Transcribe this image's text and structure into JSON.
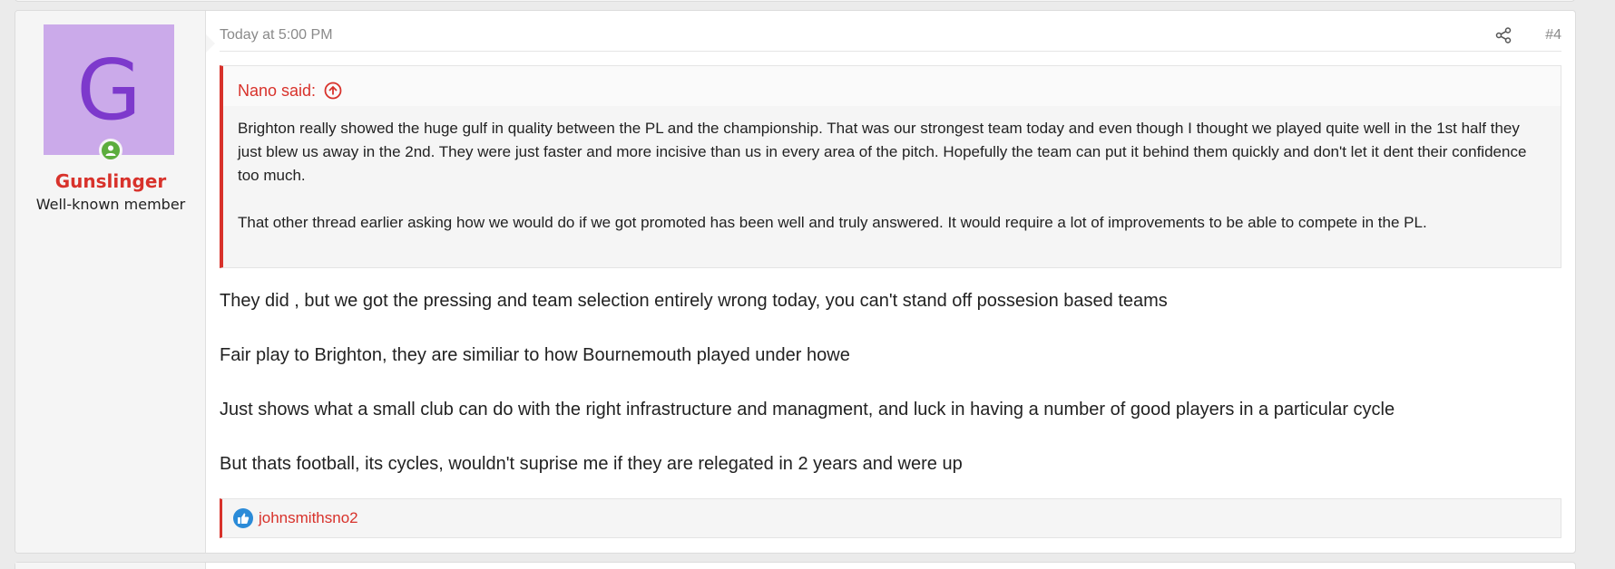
{
  "post": {
    "author": {
      "avatar_letter": "G",
      "username": "Gunslinger",
      "title": "Well-known member",
      "avatar_bg": "#cbaaea",
      "avatar_fg": "#7d39cc",
      "online_icon": "user-online-icon"
    },
    "header": {
      "timestamp": "Today at 5:00 PM",
      "share_icon": "share-icon",
      "post_number": "#4"
    },
    "quote": {
      "attribution": "Nano said:",
      "jump_icon": "arrow-up-circle-icon",
      "paragraphs": [
        "Brighton really showed the huge gulf in quality between the PL and the championship. That was our strongest team today and even though I thought we played quite well in the 1st half they just blew us away in the 2nd. They were just faster and more incisive than us in every area of the pitch. Hopefully the team can put it behind them quickly and don't let it dent their confidence too much.",
        "That other thread earlier asking how we would do if we got promoted has been well and truly answered. It would require a lot of improvements to be able to compete in the PL."
      ]
    },
    "message": [
      "They did , but we got the pressing and team selection entirely wrong today, you can't stand off possesion based teams",
      "Fair play to Brighton, they are similiar to how Bournemouth played under howe",
      "Just shows what a small club can do with the right infrastructure and managment, and luck in having a number of good players in a particular cycle",
      "But thats football, its cycles, wouldn't suprise me if they are relegated in 2 years and were up"
    ],
    "reactions": {
      "icon": "like-thumbs-up-icon",
      "users": "johnsmithsno2"
    }
  },
  "colors": {
    "accent": "#d8322b",
    "like": "#2b8bd8",
    "online": "#5cad3d"
  }
}
